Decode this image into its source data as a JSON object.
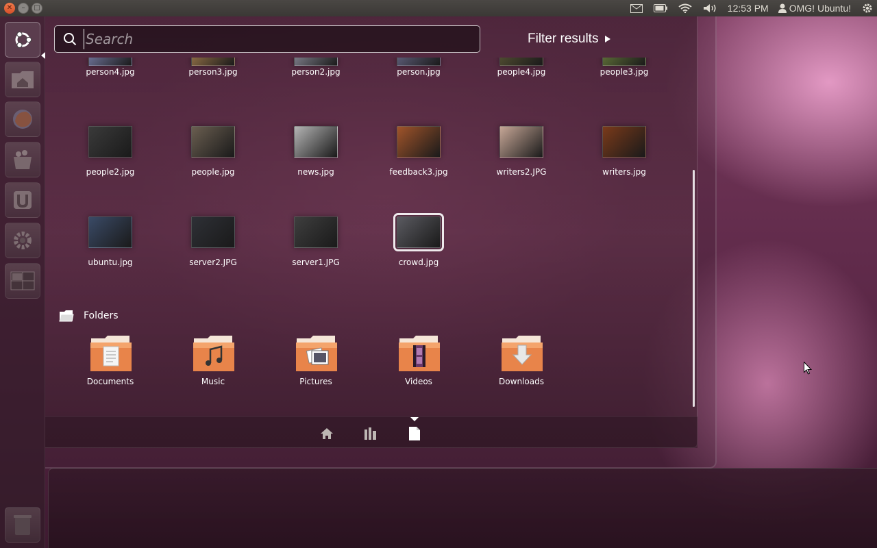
{
  "top_panel": {
    "window_buttons": [
      {
        "name": "close",
        "glyph": "✕"
      },
      {
        "name": "minimize",
        "glyph": "–"
      },
      {
        "name": "maximize",
        "glyph": "□"
      }
    ],
    "time": "12:53 PM",
    "user": "OMG! Ubuntu!",
    "indicators": [
      "mail-icon",
      "battery-icon",
      "wifi-icon",
      "volume-icon",
      "user-icon",
      "session-gear-icon"
    ]
  },
  "launcher": {
    "items": [
      {
        "name": "ubuntu-logo-icon",
        "active": true
      },
      {
        "name": "home-folder-icon"
      },
      {
        "name": "firefox-icon"
      },
      {
        "name": "software-center-icon"
      },
      {
        "name": "ubuntu-one-icon"
      },
      {
        "name": "system-settings-icon"
      },
      {
        "name": "workspace-switcher-icon"
      },
      {
        "name": "trash-icon"
      }
    ]
  },
  "dash": {
    "search_placeholder": "Search",
    "filter_label": "Filter results",
    "files": [
      {
        "label": "person4.jpg",
        "color": "#6a6e92"
      },
      {
        "label": "person3.jpg",
        "color": "#8a6a44"
      },
      {
        "label": "person2.jpg",
        "color": "#7a7a86"
      },
      {
        "label": "person.jpg",
        "color": "#5a5a74"
      },
      {
        "label": "people4.jpg",
        "color": "#4e4a30"
      },
      {
        "label": "people3.jpg",
        "color": "#5a6a36"
      },
      {
        "label": "people2.jpg",
        "color": "#3a3a3a"
      },
      {
        "label": "people.jpg",
        "color": "#6a5e50"
      },
      {
        "label": "news.jpg",
        "color": "#b4b4b4"
      },
      {
        "label": "feedback3.jpg",
        "color": "#a0542a"
      },
      {
        "label": "writers2.JPG",
        "color": "#c6a696"
      },
      {
        "label": "writers.jpg",
        "color": "#7a3a1a"
      },
      {
        "label": "ubuntu.jpg",
        "color": "#3a4a66"
      },
      {
        "label": "server2.JPG",
        "color": "#2e3036"
      },
      {
        "label": "server1.JPG",
        "color": "#3e3e3e"
      },
      {
        "label": "crowd.jpg",
        "color": "#5a5a60",
        "selected": true
      }
    ],
    "folders_header": "Folders",
    "folders": [
      {
        "label": "Documents",
        "emblem": "document"
      },
      {
        "label": "Music",
        "emblem": "music"
      },
      {
        "label": "Pictures",
        "emblem": "pictures"
      },
      {
        "label": "Videos",
        "emblem": "videos"
      },
      {
        "label": "Downloads",
        "emblem": "downloads"
      }
    ],
    "lenses": [
      {
        "name": "home-lens-icon"
      },
      {
        "name": "applications-lens-icon"
      },
      {
        "name": "files-lens-icon",
        "active": true
      }
    ]
  },
  "colors": {
    "folder_orange": "#e8844a",
    "accent_white": "#ffffff",
    "panel": "#3c3a37"
  }
}
